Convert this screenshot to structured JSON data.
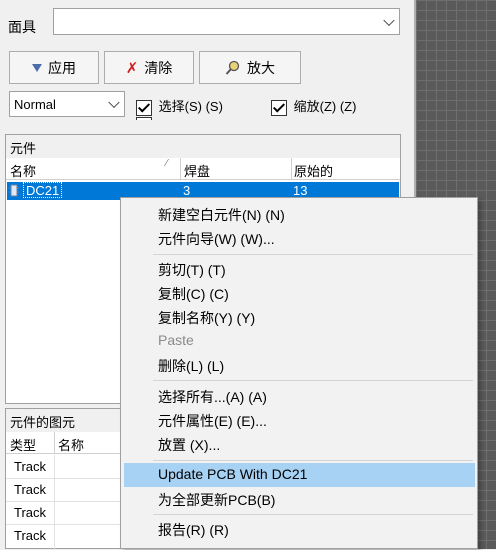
{
  "top": {
    "label": "面具",
    "combo_value": ""
  },
  "buttons": {
    "apply": "应用",
    "clear": "清除",
    "zoom": "放大"
  },
  "mode_combo": "Normal",
  "checkboxes": {
    "select": "选择(S) (S)",
    "zoom": "缩放(Z) (Z)"
  },
  "components": {
    "title": "元件",
    "columns": [
      "名称",
      "焊盘",
      "原始的"
    ],
    "row": {
      "name": "DC21",
      "pads": "3",
      "primitives": "13"
    }
  },
  "primitives": {
    "title": "元件的图元",
    "columns": [
      "类型",
      "名称"
    ],
    "rows": [
      "Track",
      "Track",
      "Track",
      "Track"
    ]
  },
  "context_menu": {
    "items": [
      "新建空白元件(N) (N)",
      "元件向导(W) (W)...",
      "剪切(T) (T)",
      "复制(C) (C)",
      "复制名称(Y) (Y)",
      "Paste",
      "删除(L) (L)",
      "选择所有...(A) (A)",
      "元件属性(E) (E)...",
      "放置 (X)...",
      "Update PCB With DC21",
      "为全部更新PCB(B)",
      "报告(R) (R)"
    ]
  },
  "colors": {
    "selection": "#0078d7",
    "menu_highlight": "#a7d2f3"
  }
}
